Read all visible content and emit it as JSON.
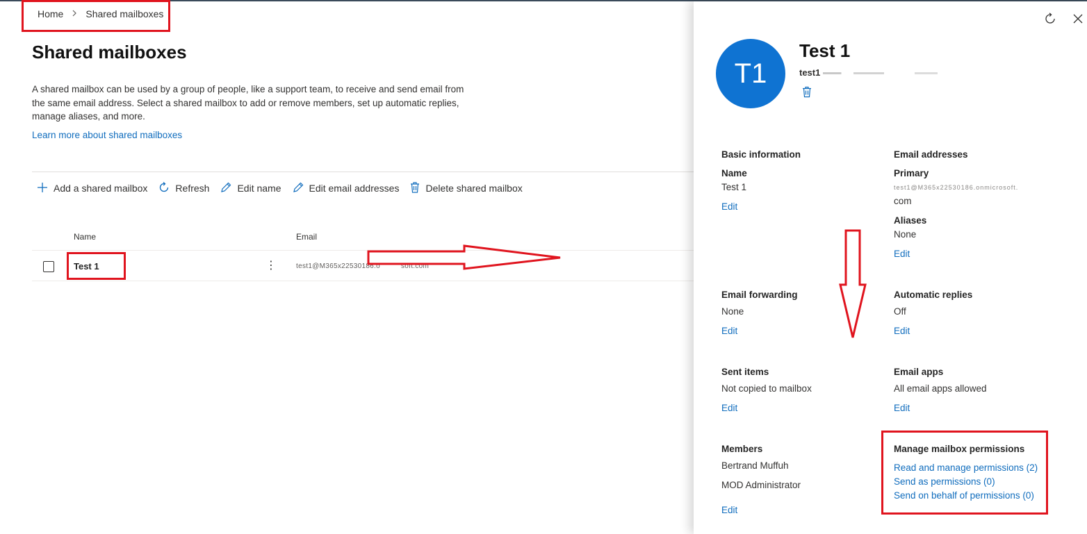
{
  "breadcrumb": {
    "home": "Home",
    "current": "Shared mailboxes"
  },
  "page": {
    "title": "Shared mailboxes",
    "description": "A shared mailbox can be used by a group of people, like a support team, to receive and send email from the same email address. Select a shared mailbox to add or remove members, set up automatic replies, manage aliases, and more.",
    "learn_more": "Learn more about shared mailboxes"
  },
  "toolbar": {
    "add": "Add a shared mailbox",
    "refresh": "Refresh",
    "edit_name": "Edit name",
    "edit_email": "Edit email addresses",
    "delete": "Delete shared mailbox"
  },
  "table": {
    "columns": [
      "Name",
      "Email"
    ],
    "rows": [
      {
        "name": "Test 1",
        "email_part1": "test1@M365x22530186.o",
        "email_part2": "soft.com"
      }
    ]
  },
  "panel": {
    "avatar_initials": "T1",
    "title": "Test 1",
    "subtitle": "test1",
    "sections": {
      "basic": {
        "title": "Basic information",
        "name_label": "Name",
        "name_value": "Test 1",
        "edit": "Edit"
      },
      "emails": {
        "title": "Email addresses",
        "primary_label": "Primary",
        "primary_value_line1": "test1@M365x22530186.onmicrosoft.",
        "primary_value_line2": "com",
        "aliases_label": "Aliases",
        "aliases_value": "None",
        "edit": "Edit"
      },
      "forwarding": {
        "title": "Email forwarding",
        "value": "None",
        "edit": "Edit"
      },
      "auto_replies": {
        "title": "Automatic replies",
        "value": "Off",
        "edit": "Edit"
      },
      "sent_items": {
        "title": "Sent items",
        "value": "Not copied to mailbox",
        "edit": "Edit"
      },
      "email_apps": {
        "title": "Email apps",
        "value": "All email apps allowed",
        "edit": "Edit"
      },
      "members": {
        "title": "Members",
        "member1": "Bertrand Muffuh",
        "member2": "MOD Administrator",
        "edit": "Edit"
      },
      "permissions": {
        "title": "Manage mailbox permissions",
        "read_manage": "Read and manage permissions (2)",
        "send_as": "Send as permissions (0)",
        "send_on_behalf": "Send on behalf of permissions (0)"
      }
    }
  },
  "colors": {
    "accent": "#0f6cbd",
    "avatar": "#0f73d2",
    "annotation_red": "#e0141e"
  },
  "icons": [
    "chevron-right-icon",
    "plus-icon",
    "refresh-icon",
    "pencil-icon",
    "trash-icon",
    "more-vertical-icon",
    "close-icon"
  ]
}
